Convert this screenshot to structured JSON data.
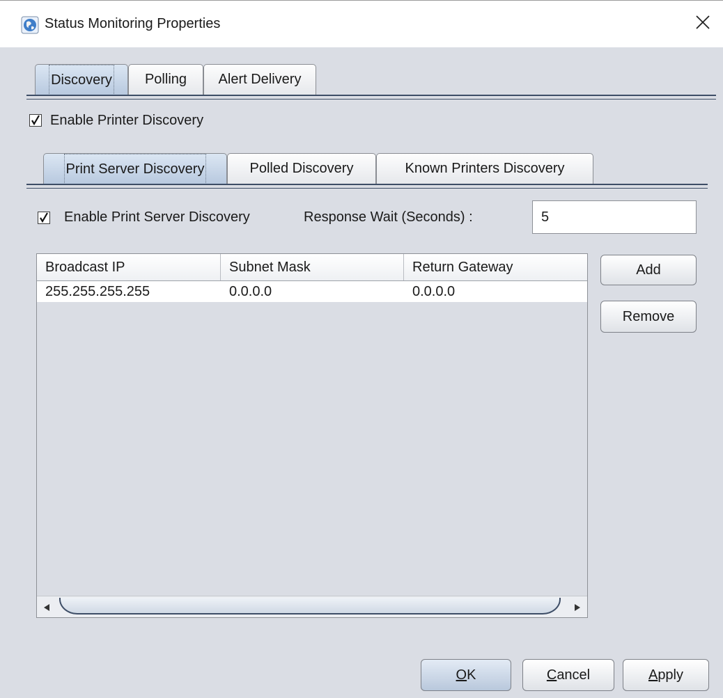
{
  "window": {
    "title": "Status Monitoring Properties",
    "icon": "globe-icon",
    "close_icon": "close-icon"
  },
  "main_tabs": [
    {
      "label": "Discovery",
      "selected": true
    },
    {
      "label": "Polling",
      "selected": false
    },
    {
      "label": "Alert Delivery",
      "selected": false
    }
  ],
  "enable_printer_discovery": {
    "label": "Enable Printer Discovery",
    "checked": true
  },
  "sub_tabs": [
    {
      "label": "Print Server Discovery",
      "selected": true
    },
    {
      "label": "Polled Discovery",
      "selected": false
    },
    {
      "label": "Known Printers Discovery",
      "selected": false
    }
  ],
  "enable_print_server_discovery": {
    "label": "Enable Print Server Discovery",
    "checked": true
  },
  "response_wait": {
    "label": "Response Wait (Seconds) :",
    "value": "5"
  },
  "table": {
    "columns": [
      "Broadcast IP",
      "Subnet Mask",
      "Return Gateway"
    ],
    "rows": [
      [
        "255.255.255.255",
        "0.0.0.0",
        "0.0.0.0"
      ]
    ]
  },
  "side_buttons": {
    "add": "Add",
    "remove": "Remove"
  },
  "footer": {
    "ok_mnemonic": "O",
    "ok_rest": "K",
    "cancel_mnemonic": "C",
    "cancel_rest": "ancel",
    "apply_mnemonic": "A",
    "apply_rest": "pply"
  },
  "colors": {
    "dialog_bg": "#dadde4",
    "selected_tab": "#c6d4e6",
    "accent_line": "#3d4d66"
  }
}
